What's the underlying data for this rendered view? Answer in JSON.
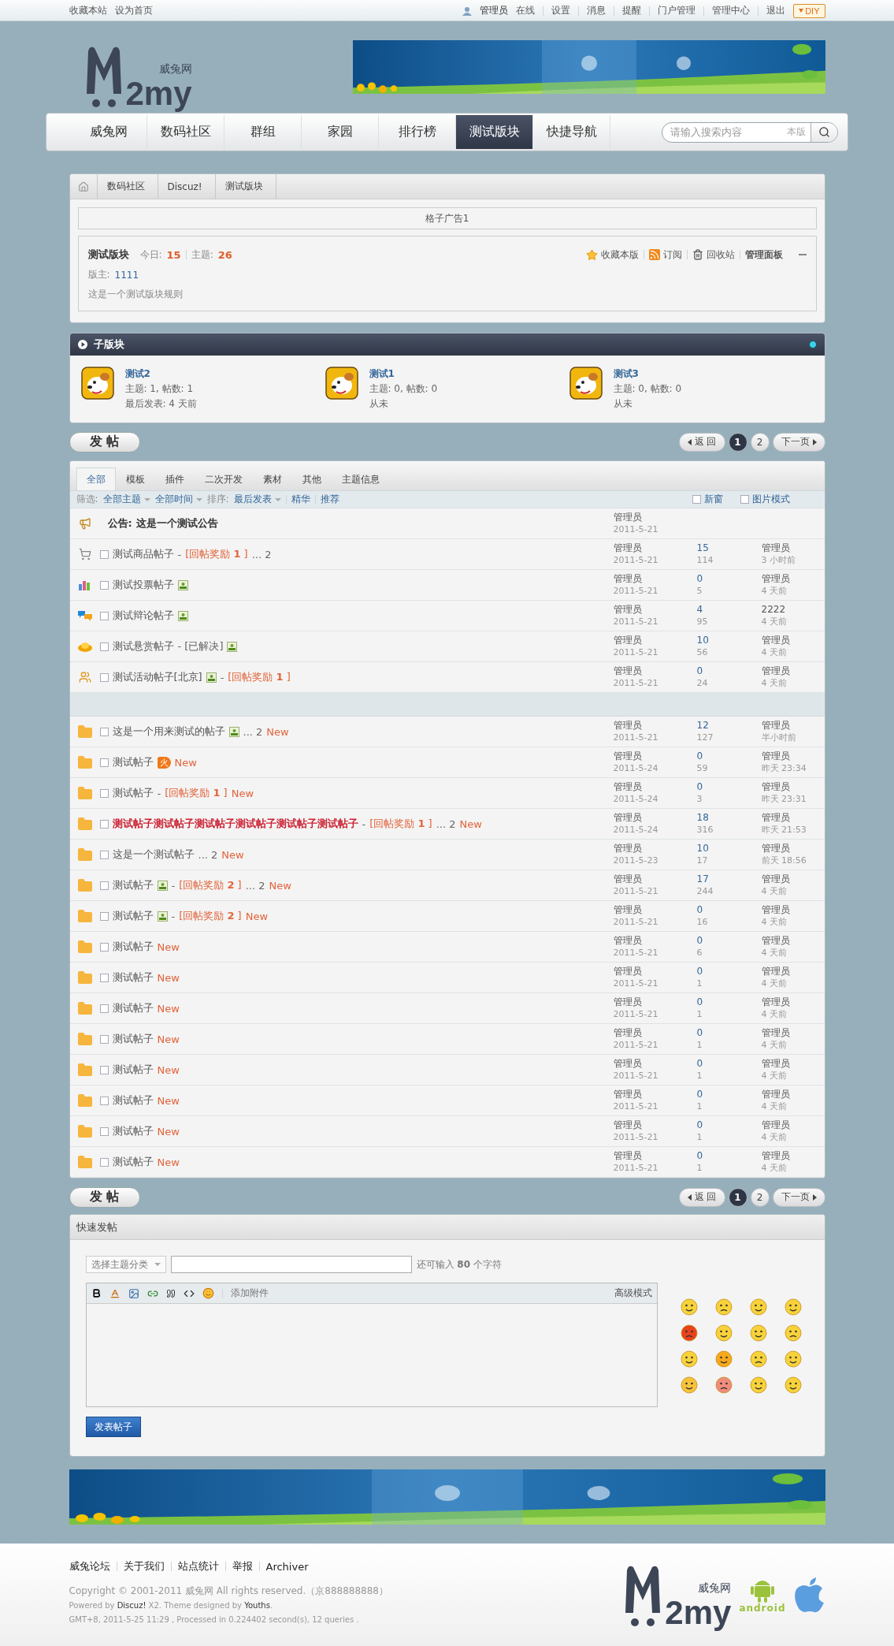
{
  "top_bar": {
    "left_links": [
      "收藏本站",
      "设为首页"
    ],
    "user": "管理员",
    "right_links": [
      "在线",
      "设置",
      "消息",
      "提醒",
      "门户管理",
      "管理中心",
      "退出"
    ],
    "diy": "DIY"
  },
  "header": {
    "logo_text": "2my",
    "logo_name": "威兔网",
    "banner": {
      "kind": "picture"
    }
  },
  "nav": {
    "items": [
      {
        "label": "威兔网",
        "selected": false
      },
      {
        "label": "数码社区",
        "selected": false
      },
      {
        "label": "群组",
        "selected": false
      },
      {
        "label": "家园",
        "selected": false
      },
      {
        "label": "排行榜",
        "selected": false
      },
      {
        "label": "测试版块",
        "selected": true
      },
      {
        "label": "快捷导航",
        "selected": false
      }
    ],
    "search": {
      "placeholder": "请输入搜索内容",
      "scope": "本版"
    }
  },
  "breadcrumb": [
    "数码社区",
    "Discuz!",
    "测试版块"
  ],
  "ad_slot": "格子广告1",
  "forum_info": {
    "name": "测试版块",
    "today_label": "今日:",
    "today": "15",
    "topics_label": "主题:",
    "topics": "26",
    "actions": [
      {
        "kind": "star",
        "label": "收藏本版"
      },
      {
        "kind": "rss",
        "label": "订阅"
      },
      {
        "kind": "trash",
        "label": "回收站"
      },
      {
        "kind": "plain",
        "label": "管理面板"
      }
    ],
    "moderator_label": "版主:",
    "moderator": "1111",
    "rules": "这是一个测试版块规则"
  },
  "subforums": {
    "title": "子版块",
    "items": [
      {
        "name": "测试2",
        "stats": "主题: 1, 帖数: 1",
        "last": "最后发表: 4 天前"
      },
      {
        "name": "测试1",
        "stats": "主题: 0, 帖数: 0",
        "last": "从未"
      },
      {
        "name": "测试3",
        "stats": "主题: 0, 帖数: 0",
        "last": "从未"
      }
    ]
  },
  "top_actions": {
    "post": "发 帖",
    "back": "返 回",
    "pages": [
      {
        "label": "1",
        "selected": true
      },
      {
        "label": "2",
        "selected": false
      }
    ],
    "next": "下一页"
  },
  "thread_list": {
    "tabs": [
      {
        "label": "全部",
        "selected": true
      },
      {
        "label": "模板",
        "selected": false
      },
      {
        "label": "插件",
        "selected": false
      },
      {
        "label": "二次开发",
        "selected": false
      },
      {
        "label": "素材",
        "selected": false
      },
      {
        "label": "其他",
        "selected": false
      },
      {
        "label": "主题信息",
        "selected": false
      }
    ],
    "filter": {
      "label": "筛选:",
      "type": "全部主题",
      "time": "全部时间",
      "sort_label": "排序:",
      "sort": "最后发表",
      "digest": "精华",
      "recommend": "推荐"
    },
    "options": [
      {
        "label": "新窗",
        "checked": false
      },
      {
        "label": "图片模式",
        "checked": false
      }
    ],
    "announcement": {
      "label": "公告:",
      "title": "这是一个测试公告",
      "author": "管理员",
      "date": "2011-5-21"
    },
    "sticky_threads": [
      {
        "kind": "trade",
        "checked": false,
        "title": "测试商品帖子",
        "highlighted": false,
        "image": false,
        "dash": "-",
        "reward": "[回帖奖励 **1** ]",
        "pages": "... 2",
        "author": "管理员",
        "date": "2011-5-21",
        "replies": "15",
        "views": "114",
        "last_poster": "管理员",
        "last_time": "3 小时前"
      },
      {
        "kind": "poll",
        "checked": false,
        "title": "测试投票帖子",
        "highlighted": false,
        "image": true,
        "author": "管理员",
        "date": "2011-5-21",
        "replies": "0",
        "views": "5",
        "last_poster": "管理员",
        "last_time": "4 天前"
      },
      {
        "kind": "debate",
        "checked": false,
        "title": "测试辩论帖子",
        "highlighted": false,
        "image": true,
        "author": "管理员",
        "date": "2011-5-21",
        "replies": "4",
        "views": "95",
        "last_poster": "2222",
        "last_time": "4 天前"
      },
      {
        "kind": "reward",
        "checked": false,
        "title": "测试悬赏帖子",
        "highlighted": false,
        "extra": "- [已解决]",
        "image": true,
        "author": "管理员",
        "date": "2011-5-21",
        "replies": "10",
        "views": "56",
        "last_poster": "管理员",
        "last_time": "4 天前"
      },
      {
        "kind": "activity",
        "checked": false,
        "title": "测试活动帖子[北京]",
        "highlighted": false,
        "image": true,
        "dash": "-",
        "reward": "[回帖奖励 **1** ]",
        "author": "管理员",
        "date": "2011-5-21",
        "replies": "0",
        "views": "24",
        "last_poster": "管理员",
        "last_time": "4 天前"
      }
    ],
    "threads": [
      {
        "kind": "folder",
        "checked": false,
        "title": "这是一个用来测试的帖子",
        "highlighted": false,
        "image": true,
        "pages": "... 2",
        "new": "New",
        "author": "管理员",
        "date": "2011-5-21",
        "replies": "12",
        "views": "127",
        "last_poster": "管理员",
        "last_time": "半小时前"
      },
      {
        "kind": "folder",
        "checked": false,
        "title": "测试帖子",
        "highlighted": false,
        "image": false,
        "hot": "火",
        "new": "New",
        "author": "管理员",
        "date": "2011-5-24",
        "replies": "0",
        "views": "59",
        "last_poster": "管理员",
        "last_time": "昨天 23:34"
      },
      {
        "kind": "folder",
        "checked": false,
        "title": "测试帖子",
        "highlighted": false,
        "image": false,
        "dash": "-",
        "reward": "[回帖奖励 **1** ]",
        "new": "New",
        "author": "管理员",
        "date": "2011-5-24",
        "replies": "0",
        "views": "3",
        "last_poster": "管理员",
        "last_time": "昨天 23:31"
      },
      {
        "kind": "folder",
        "checked": false,
        "title": "测试帖子测试帖子测试帖子测试帖子测试帖子测试帖子",
        "highlighted": true,
        "image": false,
        "dash": "-",
        "reward": "[回帖奖励 **1** ]",
        "pages": "... 2",
        "new": "New",
        "author": "管理员",
        "date": "2011-5-24",
        "replies": "18",
        "views": "316",
        "last_poster": "管理员",
        "last_time": "昨天 21:53"
      },
      {
        "kind": "folder",
        "checked": false,
        "title": "这是一个测试帖子",
        "highlighted": false,
        "image": false,
        "pages": "... 2",
        "new": "New",
        "author": "管理员",
        "date": "2011-5-23",
        "replies": "10",
        "views": "17",
        "last_poster": "管理员",
        "last_time": "前天 18:56"
      },
      {
        "kind": "folder",
        "checked": false,
        "title": "测试帖子",
        "highlighted": false,
        "image": true,
        "dash": "-",
        "reward": "[回帖奖励 **2** ]",
        "pages": "... 2",
        "new": "New",
        "author": "管理员",
        "date": "2011-5-21",
        "replies": "17",
        "views": "244",
        "last_poster": "管理员",
        "last_time": "4 天前"
      },
      {
        "kind": "folder",
        "checked": false,
        "title": "测试帖子",
        "highlighted": false,
        "image": true,
        "dash": "-",
        "reward": "[回帖奖励 **2** ]",
        "new": "New",
        "author": "管理员",
        "date": "2011-5-21",
        "replies": "0",
        "views": "16",
        "last_poster": "管理员",
        "last_time": "4 天前"
      },
      {
        "kind": "folder",
        "checked": false,
        "title": "测试帖子",
        "highlighted": false,
        "image": false,
        "new": "New",
        "author": "管理员",
        "date": "2011-5-21",
        "replies": "0",
        "views": "6",
        "last_poster": "管理员",
        "last_time": "4 天前"
      },
      {
        "kind": "folder",
        "checked": false,
        "title": "测试帖子",
        "highlighted": false,
        "image": false,
        "new": "New",
        "author": "管理员",
        "date": "2011-5-21",
        "replies": "0",
        "views": "1",
        "last_poster": "管理员",
        "last_time": "4 天前"
      },
      {
        "kind": "folder",
        "checked": false,
        "title": "测试帖子",
        "highlighted": false,
        "image": false,
        "new": "New",
        "author": "管理员",
        "date": "2011-5-21",
        "replies": "0",
        "views": "1",
        "last_poster": "管理员",
        "last_time": "4 天前"
      },
      {
        "kind": "folder",
        "checked": false,
        "title": "测试帖子",
        "highlighted": false,
        "image": false,
        "new": "New",
        "author": "管理员",
        "date": "2011-5-21",
        "replies": "0",
        "views": "1",
        "last_poster": "管理员",
        "last_time": "4 天前"
      },
      {
        "kind": "folder",
        "checked": false,
        "title": "测试帖子",
        "highlighted": false,
        "image": false,
        "new": "New",
        "author": "管理员",
        "date": "2011-5-21",
        "replies": "0",
        "views": "1",
        "last_poster": "管理员",
        "last_time": "4 天前"
      },
      {
        "kind": "folder",
        "checked": false,
        "title": "测试帖子",
        "highlighted": false,
        "image": false,
        "new": "New",
        "author": "管理员",
        "date": "2011-5-21",
        "replies": "0",
        "views": "1",
        "last_poster": "管理员",
        "last_time": "4 天前"
      },
      {
        "kind": "folder",
        "checked": false,
        "title": "测试帖子",
        "highlighted": false,
        "image": false,
        "new": "New",
        "author": "管理员",
        "date": "2011-5-21",
        "replies": "0",
        "views": "1",
        "last_poster": "管理员",
        "last_time": "4 天前"
      },
      {
        "kind": "folder",
        "checked": false,
        "title": "测试帖子",
        "highlighted": false,
        "image": false,
        "new": "New",
        "author": "管理员",
        "date": "2011-5-21",
        "replies": "0",
        "views": "1",
        "last_poster": "管理员",
        "last_time": "4 天前"
      }
    ]
  },
  "bottom_actions": {
    "post": "发 帖",
    "back": "返 回",
    "pages": [
      {
        "label": "1",
        "selected": true
      },
      {
        "label": "2",
        "selected": false
      }
    ],
    "next": "下一页"
  },
  "quick_post": {
    "title": "快速发帖",
    "category": "选择主题分类",
    "remaining": "还可输入 **80** 个字符",
    "attach": "添加附件",
    "advanced": "高级模式",
    "submit": "发表帖子"
  },
  "bottom_banner": {
    "kind": "picture"
  },
  "footer": {
    "links": [
      "威兔论坛",
      "关于我们",
      "站点统计",
      "举报",
      "Archiver"
    ],
    "copyright": "Copyright © 2001-2011 威兔网 All rights reserved.（京888888888）",
    "powered": "Powered by **Discuz!** X2. Theme designed by **Youths**.",
    "stats": "GMT+8, 2011-5-25 11:29 , Processed in 0.224402 second(s), 12 queries .",
    "logo_text": "2my",
    "logo_name": "威兔网",
    "android": "android"
  }
}
